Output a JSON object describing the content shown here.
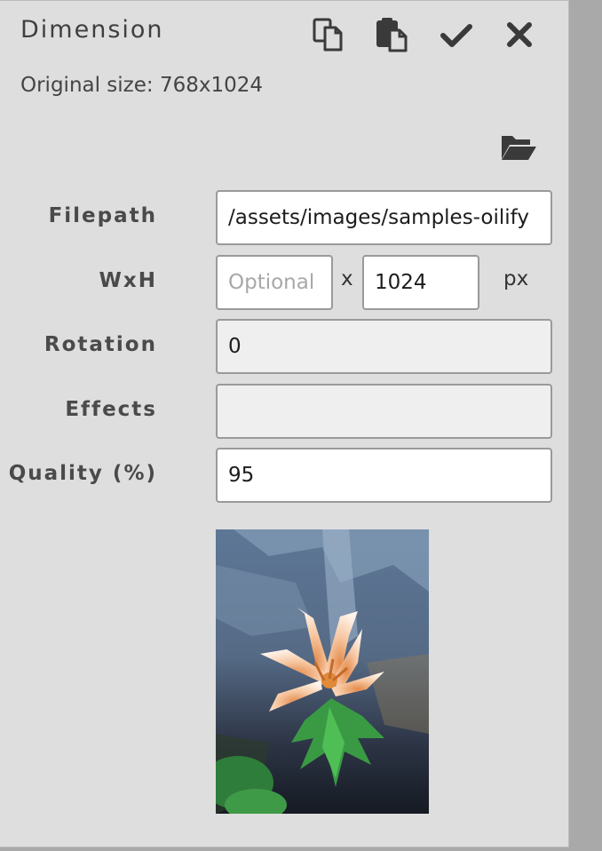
{
  "dialog": {
    "title": "Dimension",
    "original_size_text": "Original size: 768x1024"
  },
  "toolbar": {
    "icons": [
      "copy-icon",
      "paste-icon",
      "check-icon",
      "close-icon"
    ],
    "folder_icon": "folder-open-icon"
  },
  "form": {
    "filepath": {
      "label": "Filepath",
      "value": "/assets/images/samples-oilify"
    },
    "wxh": {
      "label": "WxH",
      "width_placeholder": "Optional",
      "width_value": "",
      "separator": "x",
      "height_value": "1024",
      "unit": "px"
    },
    "rotation": {
      "label": "Rotation",
      "value": "0"
    },
    "effects": {
      "label": "Effects",
      "value": ""
    },
    "quality": {
      "label": "Quality (%)",
      "value": "95"
    }
  },
  "colors": {
    "panel_bg": "#dedede",
    "field_border": "#9a9a9a",
    "readonly_bg": "#efefef",
    "scrollbar": "#a9a9a9"
  }
}
